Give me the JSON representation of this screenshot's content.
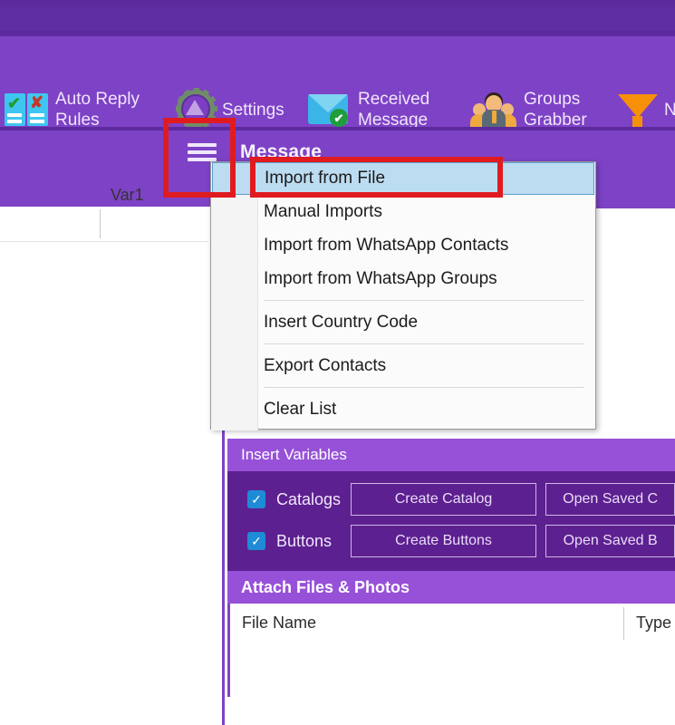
{
  "app": {
    "theme": {
      "toolbar_purple": "#7e42c6",
      "dark_purple": "#5c2a9d",
      "panel_purple": "#5d2090",
      "card_header_purple": "#9751d8",
      "highlight_blue": "#bcdcf1",
      "annotation_red": "#e01b20",
      "checkbox_blue": "#1e8bd6"
    }
  },
  "toolbar": {
    "items": [
      {
        "label": "Auto Reply\nRules",
        "icon": "auto-reply-book-icon"
      },
      {
        "label": "Settings",
        "icon": "gear-icon"
      },
      {
        "label": "Received\nMessage",
        "icon": "envelope-check-icon"
      },
      {
        "label": "Groups\nGrabber",
        "icon": "groups-people-icon"
      },
      {
        "label": "N",
        "icon": "funnel-filter-icon"
      }
    ]
  },
  "band": {
    "menu_icon": "hamburger-icon",
    "title": "Message"
  },
  "grid": {
    "column_header": "Var1"
  },
  "menu": {
    "items": [
      {
        "label": "Import from File",
        "selected": true
      },
      {
        "label": "Manual Imports",
        "selected": false
      },
      {
        "label": "Import from WhatsApp Contacts",
        "selected": false
      },
      {
        "label": "Import from WhatsApp Groups",
        "selected": false
      },
      {
        "label": "Insert Country Code",
        "selected": false
      },
      {
        "label": "Export Contacts",
        "selected": false
      },
      {
        "label": "Clear List",
        "selected": false
      }
    ]
  },
  "insert_variables": {
    "header": "Insert Variables",
    "rows": [
      {
        "checkbox_checked": "✓",
        "label": "Catalogs",
        "create_button": "Create Catalog",
        "open_button": "Open Saved C"
      },
      {
        "checkbox_checked": "✓",
        "label": "Buttons",
        "create_button": "Create Buttons",
        "open_button": "Open Saved B"
      }
    ]
  },
  "attach": {
    "header": "Attach Files & Photos",
    "columns": [
      "File Name",
      "Type"
    ]
  }
}
